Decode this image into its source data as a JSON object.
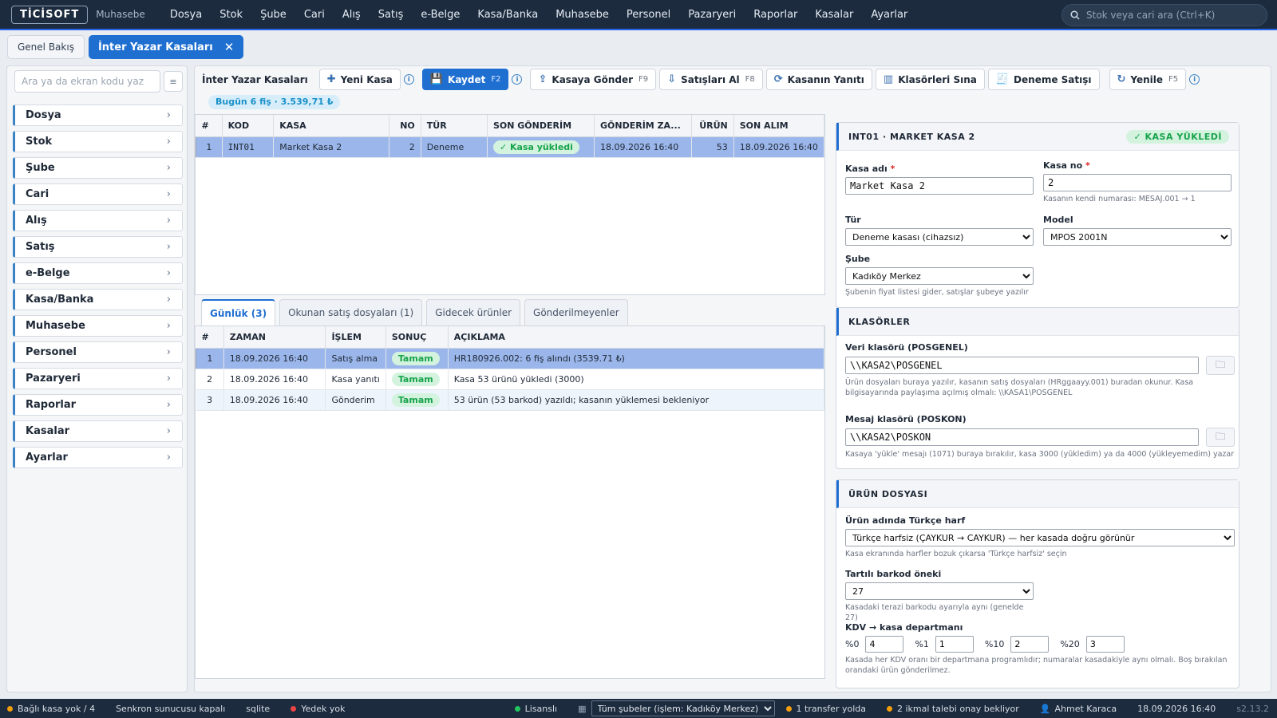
{
  "app": {
    "logo": "TİCİSOFT",
    "subtitle": "Muhasebe"
  },
  "topmenu": [
    "Dosya",
    "Stok",
    "Şube",
    "Cari",
    "Alış",
    "Satış",
    "e-Belge",
    "Kasa/Banka",
    "Muhasebe",
    "Personel",
    "Pazaryeri",
    "Raporlar",
    "Kasalar",
    "Ayarlar"
  ],
  "search": {
    "placeholder": "Stok veya cari ara (Ctrl+K)"
  },
  "tabs": {
    "overview": "Genel Bakış",
    "active": "İnter Yazar Kasaları",
    "close": "✕"
  },
  "sidebar": {
    "search_placeholder": "Ara ya da ekran kodu yaz",
    "items": [
      "Dosya",
      "Stok",
      "Şube",
      "Cari",
      "Alış",
      "Satış",
      "e-Belge",
      "Kasa/Banka",
      "Muhasebe",
      "Personel",
      "Pazaryeri",
      "Raporlar",
      "Kasalar",
      "Ayarlar"
    ]
  },
  "toolbar": {
    "title": "İnter Yazar Kasaları",
    "new": "Yeni Kasa",
    "save": "Kaydet",
    "save_key": "F2",
    "send": "Kasaya Gönder",
    "send_key": "F9",
    "receive": "Satışları Al",
    "receive_key": "F8",
    "response": "Kasanın Yanıtı",
    "test_folders": "Klasörleri Sına",
    "test_sale": "Deneme Satışı",
    "refresh": "Yenile",
    "refresh_key": "F5"
  },
  "today": "Bugün 6 fiş · 3.539,71 ₺",
  "registers": {
    "columns": [
      "#",
      "KOD",
      "KASA",
      "NO",
      "TÜR",
      "SON GÖNDERİM",
      "GÖNDERİM ZA...",
      "ÜRÜN",
      "SON ALIM"
    ],
    "rows": [
      {
        "n": "1",
        "code": "INT01",
        "name": "Market Kasa 2",
        "no": "2",
        "type": "Deneme",
        "last_send": "✓ Kasa yükledi",
        "send_time": "18.09.2026 16:40",
        "products": "53",
        "last_recv": "18.09.2026 16:40"
      }
    ]
  },
  "subtabs": [
    "Günlük (3)",
    "Okunan satış dosyaları (1)",
    "Gidecek ürünler",
    "Gönderilmeyenler"
  ],
  "log": {
    "columns": [
      "#",
      "ZAMAN",
      "İŞLEM",
      "SONUÇ",
      "AÇIKLAMA"
    ],
    "rows": [
      {
        "n": "1",
        "time": "18.09.2026 16:40",
        "op": "Satış alma",
        "result": "Tamam",
        "desc": "HR180926.002: 6 fiş alındı (3539.71 ₺)"
      },
      {
        "n": "2",
        "time": "18.09.2026 16:40",
        "op": "Kasa yanıtı",
        "result": "Tamam",
        "desc": "Kasa 53 ürünü yükledi (3000)"
      },
      {
        "n": "3",
        "time": "18.09.2026 16:40",
        "op": "Gönderim",
        "result": "Tamam",
        "desc": "53 ürün (53 barkod) yazıldı; kasanın yüklemesi bekleniyor"
      }
    ]
  },
  "detail": {
    "title": "INT01 · MARKET KASA 2",
    "status": "✓ KASA YÜKLEDİ",
    "name_label": "Kasa adı",
    "name_value": "Market Kasa 2",
    "no_label": "Kasa no",
    "no_value": "2",
    "no_hint": "Kasanın kendi numarası: MESAJ.001 → 1",
    "type_label": "Tür",
    "type_value": "Deneme kasası (cihazsız)",
    "model_label": "Model",
    "model_value": "MPOS 2001N",
    "branch_label": "Şube",
    "branch_value": "Kadıköy Merkez",
    "branch_hint": "Şubenin fiyat listesi gider, satışlar şubeye yazılır"
  },
  "folders": {
    "title": "KLASÖRLER",
    "data_label": "Veri klasörü (POSGENEL)",
    "data_value": "\\\\KASA2\\POSGENEL",
    "data_hint": "Ürün dosyaları buraya yazılır, kasanın satış dosyaları (HRggaayy.001) buradan okunur. Kasa bilgisayarında paylaşıma açılmış olmalı: \\\\KASA1\\POSGENEL",
    "msg_label": "Mesaj klasörü (POSKON)",
    "msg_value": "\\\\KASA2\\POSKON",
    "msg_hint": "Kasaya 'yükle' mesajı (1071) buraya bırakılır, kasa 3000 (yükledim) ya da 4000 (yükleyemedim) yazar"
  },
  "product": {
    "title": "ÜRÜN DOSYASI",
    "turkish_label": "Ürün adında Türkçe harf",
    "turkish_value": "Türkçe harfsiz (ÇAYKUR → CAYKUR) — her kasada doğru görünür",
    "turkish_hint": "Kasa ekranında harfler bozuk çıkarsa 'Türkçe harfsiz' seçin",
    "barcode_label": "Tartılı barkod öneki",
    "barcode_value": "27",
    "barcode_hint": "Kasadaki terazi barkodu ayarıyla aynı (genelde 27)",
    "kdv_label": "KDV → kasa departmanı",
    "kdv": [
      {
        "k": "%0",
        "v": "4"
      },
      {
        "k": "%1",
        "v": "1"
      },
      {
        "k": "%10",
        "v": "2"
      },
      {
        "k": "%20",
        "v": "3"
      }
    ],
    "kdv_hint": "Kasada her KDV oranı bir departmana programlıdır; numaralar kasadakiyle aynı olmalı. Boş bırakılan orandaki ürün gönderilmez."
  },
  "status": {
    "connected": "Bağlı kasa yok / 4",
    "sync": "Senkron sunucusu kapalı",
    "db": "sqlite",
    "backup": "Yedek yok",
    "license": "Lisanslı",
    "branch": "Tüm şubeler (işlem: Kadıköy Merkez)",
    "transfer": "1 transfer yolda",
    "requests": "2 ikmal talebi onay bekliyor",
    "user": "Ahmet Karaca",
    "datetime": "18.09.2026 16:40",
    "version": "s2.13.2"
  },
  "colors": {
    "accent": "#1f6fd1",
    "topbar": "#1c2b3d",
    "success": "#17a34a",
    "selected_row": "#9bb6ea"
  }
}
